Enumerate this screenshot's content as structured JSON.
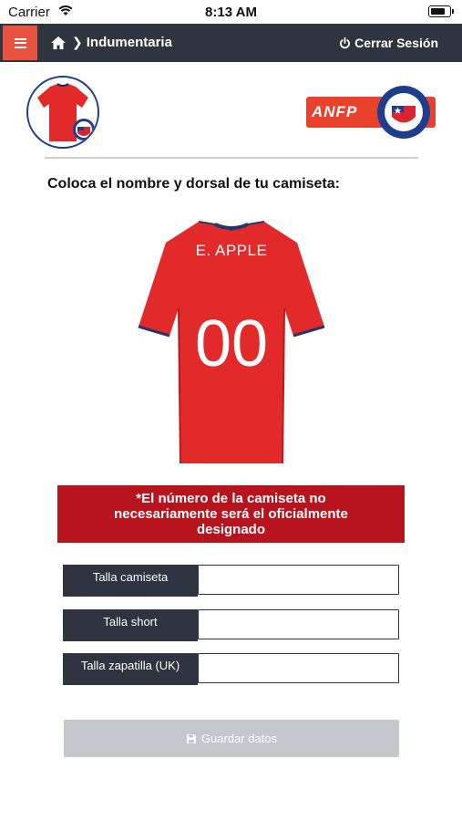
{
  "status_bar": {
    "carrier": "Carrier",
    "time": "8:13 AM"
  },
  "navbar": {
    "menu_icon": "hamburger-icon",
    "home_icon": "home-icon",
    "section": "Indumentaria",
    "logout_icon": "power-icon",
    "logout_label": "Cerrar Sesión",
    "bg_color": "#2e3540",
    "menu_color": "#e8533f"
  },
  "logos": {
    "anfp_text": "ANFP"
  },
  "heading": "Coloca el nombre y dorsal de tu camiseta:",
  "jersey": {
    "name": "E. APPLE",
    "number": "00",
    "color": "#e32a2a"
  },
  "notice": {
    "text": "*El número de la camiseta no necesariamente será el oficialmente designado",
    "color": "#b8141e"
  },
  "fields": [
    {
      "label": "Talla camiseta",
      "value": ""
    },
    {
      "label": "Talla short",
      "value": ""
    },
    {
      "label": "Talla zapatilla (UK)",
      "value": ""
    }
  ],
  "save": {
    "icon": "floppy-disk-icon",
    "label": "Guardar datos"
  }
}
